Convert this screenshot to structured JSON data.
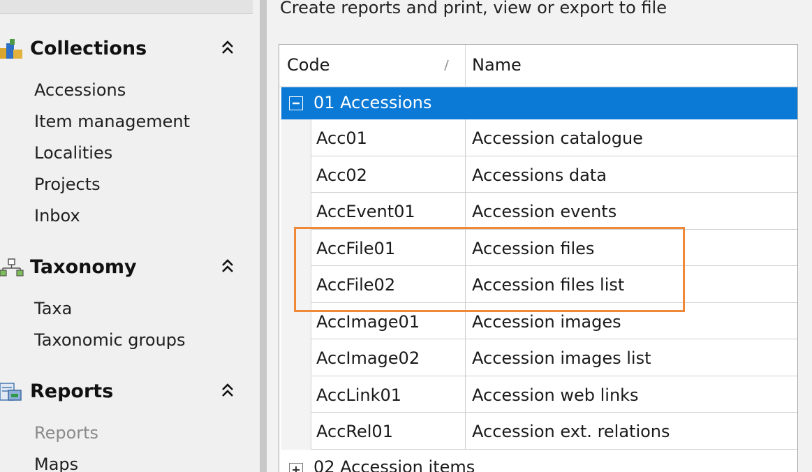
{
  "sidebar": {
    "groups": [
      {
        "title": "Collections",
        "icon": "collections-icon",
        "items": [
          "Accessions",
          "Item management",
          "Localities",
          "Projects",
          "Inbox"
        ]
      },
      {
        "title": "Taxonomy",
        "icon": "taxonomy-icon",
        "items": [
          "Taxa",
          "Taxonomic groups"
        ]
      },
      {
        "title": "Reports",
        "icon": "reports-icon",
        "items": [
          "Reports",
          "Maps"
        ]
      }
    ]
  },
  "main": {
    "subtitle": "Create reports and print, view or export to file",
    "grid": {
      "columns": [
        "Code",
        "Name"
      ],
      "groups": [
        {
          "label": "01 Accessions",
          "expanded": true,
          "selected": true,
          "rows": [
            {
              "code": "Acc01",
              "name": "Accession catalogue"
            },
            {
              "code": "Acc02",
              "name": "Accessions data"
            },
            {
              "code": "AccEvent01",
              "name": "Accession events"
            },
            {
              "code": "AccFile01",
              "name": "Accession files"
            },
            {
              "code": "AccFile02",
              "name": "Accession files list"
            },
            {
              "code": "AccImage01",
              "name": "Accession images"
            },
            {
              "code": "AccImage02",
              "name": "Accession images list"
            },
            {
              "code": "AccLink01",
              "name": "Accession web links"
            },
            {
              "code": "AccRel01",
              "name": "Accession ext. relations"
            }
          ]
        },
        {
          "label": "02 Accession items",
          "expanded": false,
          "selected": false,
          "rows": []
        }
      ]
    }
  },
  "colors": {
    "selection": "#0a7ad6",
    "highlight": "#f0883a",
    "sidebar_bg": "#f0f0f0"
  }
}
